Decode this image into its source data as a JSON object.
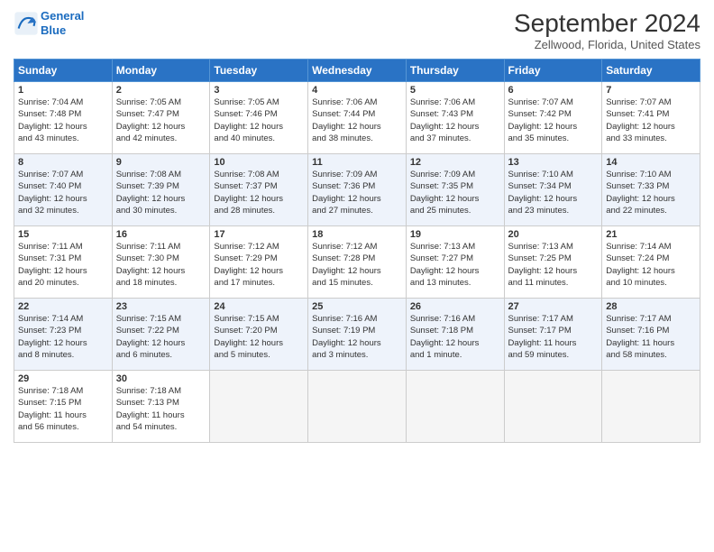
{
  "header": {
    "logo_line1": "General",
    "logo_line2": "Blue",
    "month": "September 2024",
    "location": "Zellwood, Florida, United States"
  },
  "weekdays": [
    "Sunday",
    "Monday",
    "Tuesday",
    "Wednesday",
    "Thursday",
    "Friday",
    "Saturday"
  ],
  "weeks": [
    [
      {
        "day": "1",
        "info": "Sunrise: 7:04 AM\nSunset: 7:48 PM\nDaylight: 12 hours\nand 43 minutes."
      },
      {
        "day": "2",
        "info": "Sunrise: 7:05 AM\nSunset: 7:47 PM\nDaylight: 12 hours\nand 42 minutes."
      },
      {
        "day": "3",
        "info": "Sunrise: 7:05 AM\nSunset: 7:46 PM\nDaylight: 12 hours\nand 40 minutes."
      },
      {
        "day": "4",
        "info": "Sunrise: 7:06 AM\nSunset: 7:44 PM\nDaylight: 12 hours\nand 38 minutes."
      },
      {
        "day": "5",
        "info": "Sunrise: 7:06 AM\nSunset: 7:43 PM\nDaylight: 12 hours\nand 37 minutes."
      },
      {
        "day": "6",
        "info": "Sunrise: 7:07 AM\nSunset: 7:42 PM\nDaylight: 12 hours\nand 35 minutes."
      },
      {
        "day": "7",
        "info": "Sunrise: 7:07 AM\nSunset: 7:41 PM\nDaylight: 12 hours\nand 33 minutes."
      }
    ],
    [
      {
        "day": "8",
        "info": "Sunrise: 7:07 AM\nSunset: 7:40 PM\nDaylight: 12 hours\nand 32 minutes."
      },
      {
        "day": "9",
        "info": "Sunrise: 7:08 AM\nSunset: 7:39 PM\nDaylight: 12 hours\nand 30 minutes."
      },
      {
        "day": "10",
        "info": "Sunrise: 7:08 AM\nSunset: 7:37 PM\nDaylight: 12 hours\nand 28 minutes."
      },
      {
        "day": "11",
        "info": "Sunrise: 7:09 AM\nSunset: 7:36 PM\nDaylight: 12 hours\nand 27 minutes."
      },
      {
        "day": "12",
        "info": "Sunrise: 7:09 AM\nSunset: 7:35 PM\nDaylight: 12 hours\nand 25 minutes."
      },
      {
        "day": "13",
        "info": "Sunrise: 7:10 AM\nSunset: 7:34 PM\nDaylight: 12 hours\nand 23 minutes."
      },
      {
        "day": "14",
        "info": "Sunrise: 7:10 AM\nSunset: 7:33 PM\nDaylight: 12 hours\nand 22 minutes."
      }
    ],
    [
      {
        "day": "15",
        "info": "Sunrise: 7:11 AM\nSunset: 7:31 PM\nDaylight: 12 hours\nand 20 minutes."
      },
      {
        "day": "16",
        "info": "Sunrise: 7:11 AM\nSunset: 7:30 PM\nDaylight: 12 hours\nand 18 minutes."
      },
      {
        "day": "17",
        "info": "Sunrise: 7:12 AM\nSunset: 7:29 PM\nDaylight: 12 hours\nand 17 minutes."
      },
      {
        "day": "18",
        "info": "Sunrise: 7:12 AM\nSunset: 7:28 PM\nDaylight: 12 hours\nand 15 minutes."
      },
      {
        "day": "19",
        "info": "Sunrise: 7:13 AM\nSunset: 7:27 PM\nDaylight: 12 hours\nand 13 minutes."
      },
      {
        "day": "20",
        "info": "Sunrise: 7:13 AM\nSunset: 7:25 PM\nDaylight: 12 hours\nand 11 minutes."
      },
      {
        "day": "21",
        "info": "Sunrise: 7:14 AM\nSunset: 7:24 PM\nDaylight: 12 hours\nand 10 minutes."
      }
    ],
    [
      {
        "day": "22",
        "info": "Sunrise: 7:14 AM\nSunset: 7:23 PM\nDaylight: 12 hours\nand 8 minutes."
      },
      {
        "day": "23",
        "info": "Sunrise: 7:15 AM\nSunset: 7:22 PM\nDaylight: 12 hours\nand 6 minutes."
      },
      {
        "day": "24",
        "info": "Sunrise: 7:15 AM\nSunset: 7:20 PM\nDaylight: 12 hours\nand 5 minutes."
      },
      {
        "day": "25",
        "info": "Sunrise: 7:16 AM\nSunset: 7:19 PM\nDaylight: 12 hours\nand 3 minutes."
      },
      {
        "day": "26",
        "info": "Sunrise: 7:16 AM\nSunset: 7:18 PM\nDaylight: 12 hours\nand 1 minute."
      },
      {
        "day": "27",
        "info": "Sunrise: 7:17 AM\nSunset: 7:17 PM\nDaylight: 11 hours\nand 59 minutes."
      },
      {
        "day": "28",
        "info": "Sunrise: 7:17 AM\nSunset: 7:16 PM\nDaylight: 11 hours\nand 58 minutes."
      }
    ],
    [
      {
        "day": "29",
        "info": "Sunrise: 7:18 AM\nSunset: 7:15 PM\nDaylight: 11 hours\nand 56 minutes."
      },
      {
        "day": "30",
        "info": "Sunrise: 7:18 AM\nSunset: 7:13 PM\nDaylight: 11 hours\nand 54 minutes."
      },
      {
        "day": "",
        "info": ""
      },
      {
        "day": "",
        "info": ""
      },
      {
        "day": "",
        "info": ""
      },
      {
        "day": "",
        "info": ""
      },
      {
        "day": "",
        "info": ""
      }
    ]
  ]
}
